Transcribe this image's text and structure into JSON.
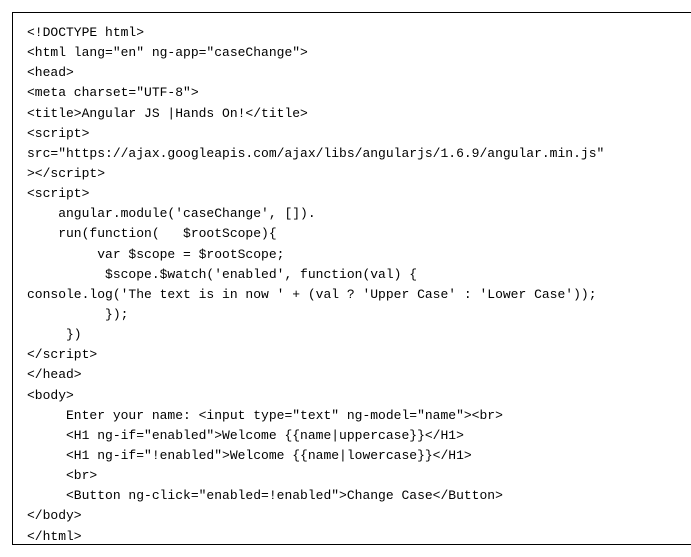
{
  "code": {
    "lines": [
      "<!DOCTYPE html>",
      "<html lang=\"en\" ng-app=\"caseChange\">",
      "<head>",
      "<meta charset=\"UTF-8\">",
      "<title>Angular JS |Hands On!</title>",
      "<script>",
      "src=\"https://ajax.googleapis.com/ajax/libs/angularjs/1.6.9/angular.min.js\"",
      "></script>",
      "<script>",
      "    angular.module('caseChange', []).",
      "    run(function(   $rootScope){",
      "         var $scope = $rootScope;",
      "          $scope.$watch('enabled', function(val) {",
      "console.log('The text is in now ' + (val ? 'Upper Case' : 'Lower Case'));",
      "          });",
      "     })",
      "</script>",
      "</head>",
      "<body>",
      "     Enter your name: <input type=\"text\" ng-model=\"name\"><br>",
      "     <H1 ng-if=\"enabled\">Welcome {{name|uppercase}}</H1>",
      "     <H1 ng-if=\"!enabled\">Welcome {{name|lowercase}}</H1>",
      "     <br>",
      "     <Button ng-click=\"enabled=!enabled\">Change Case</Button>",
      "</body>",
      "</html>"
    ]
  }
}
